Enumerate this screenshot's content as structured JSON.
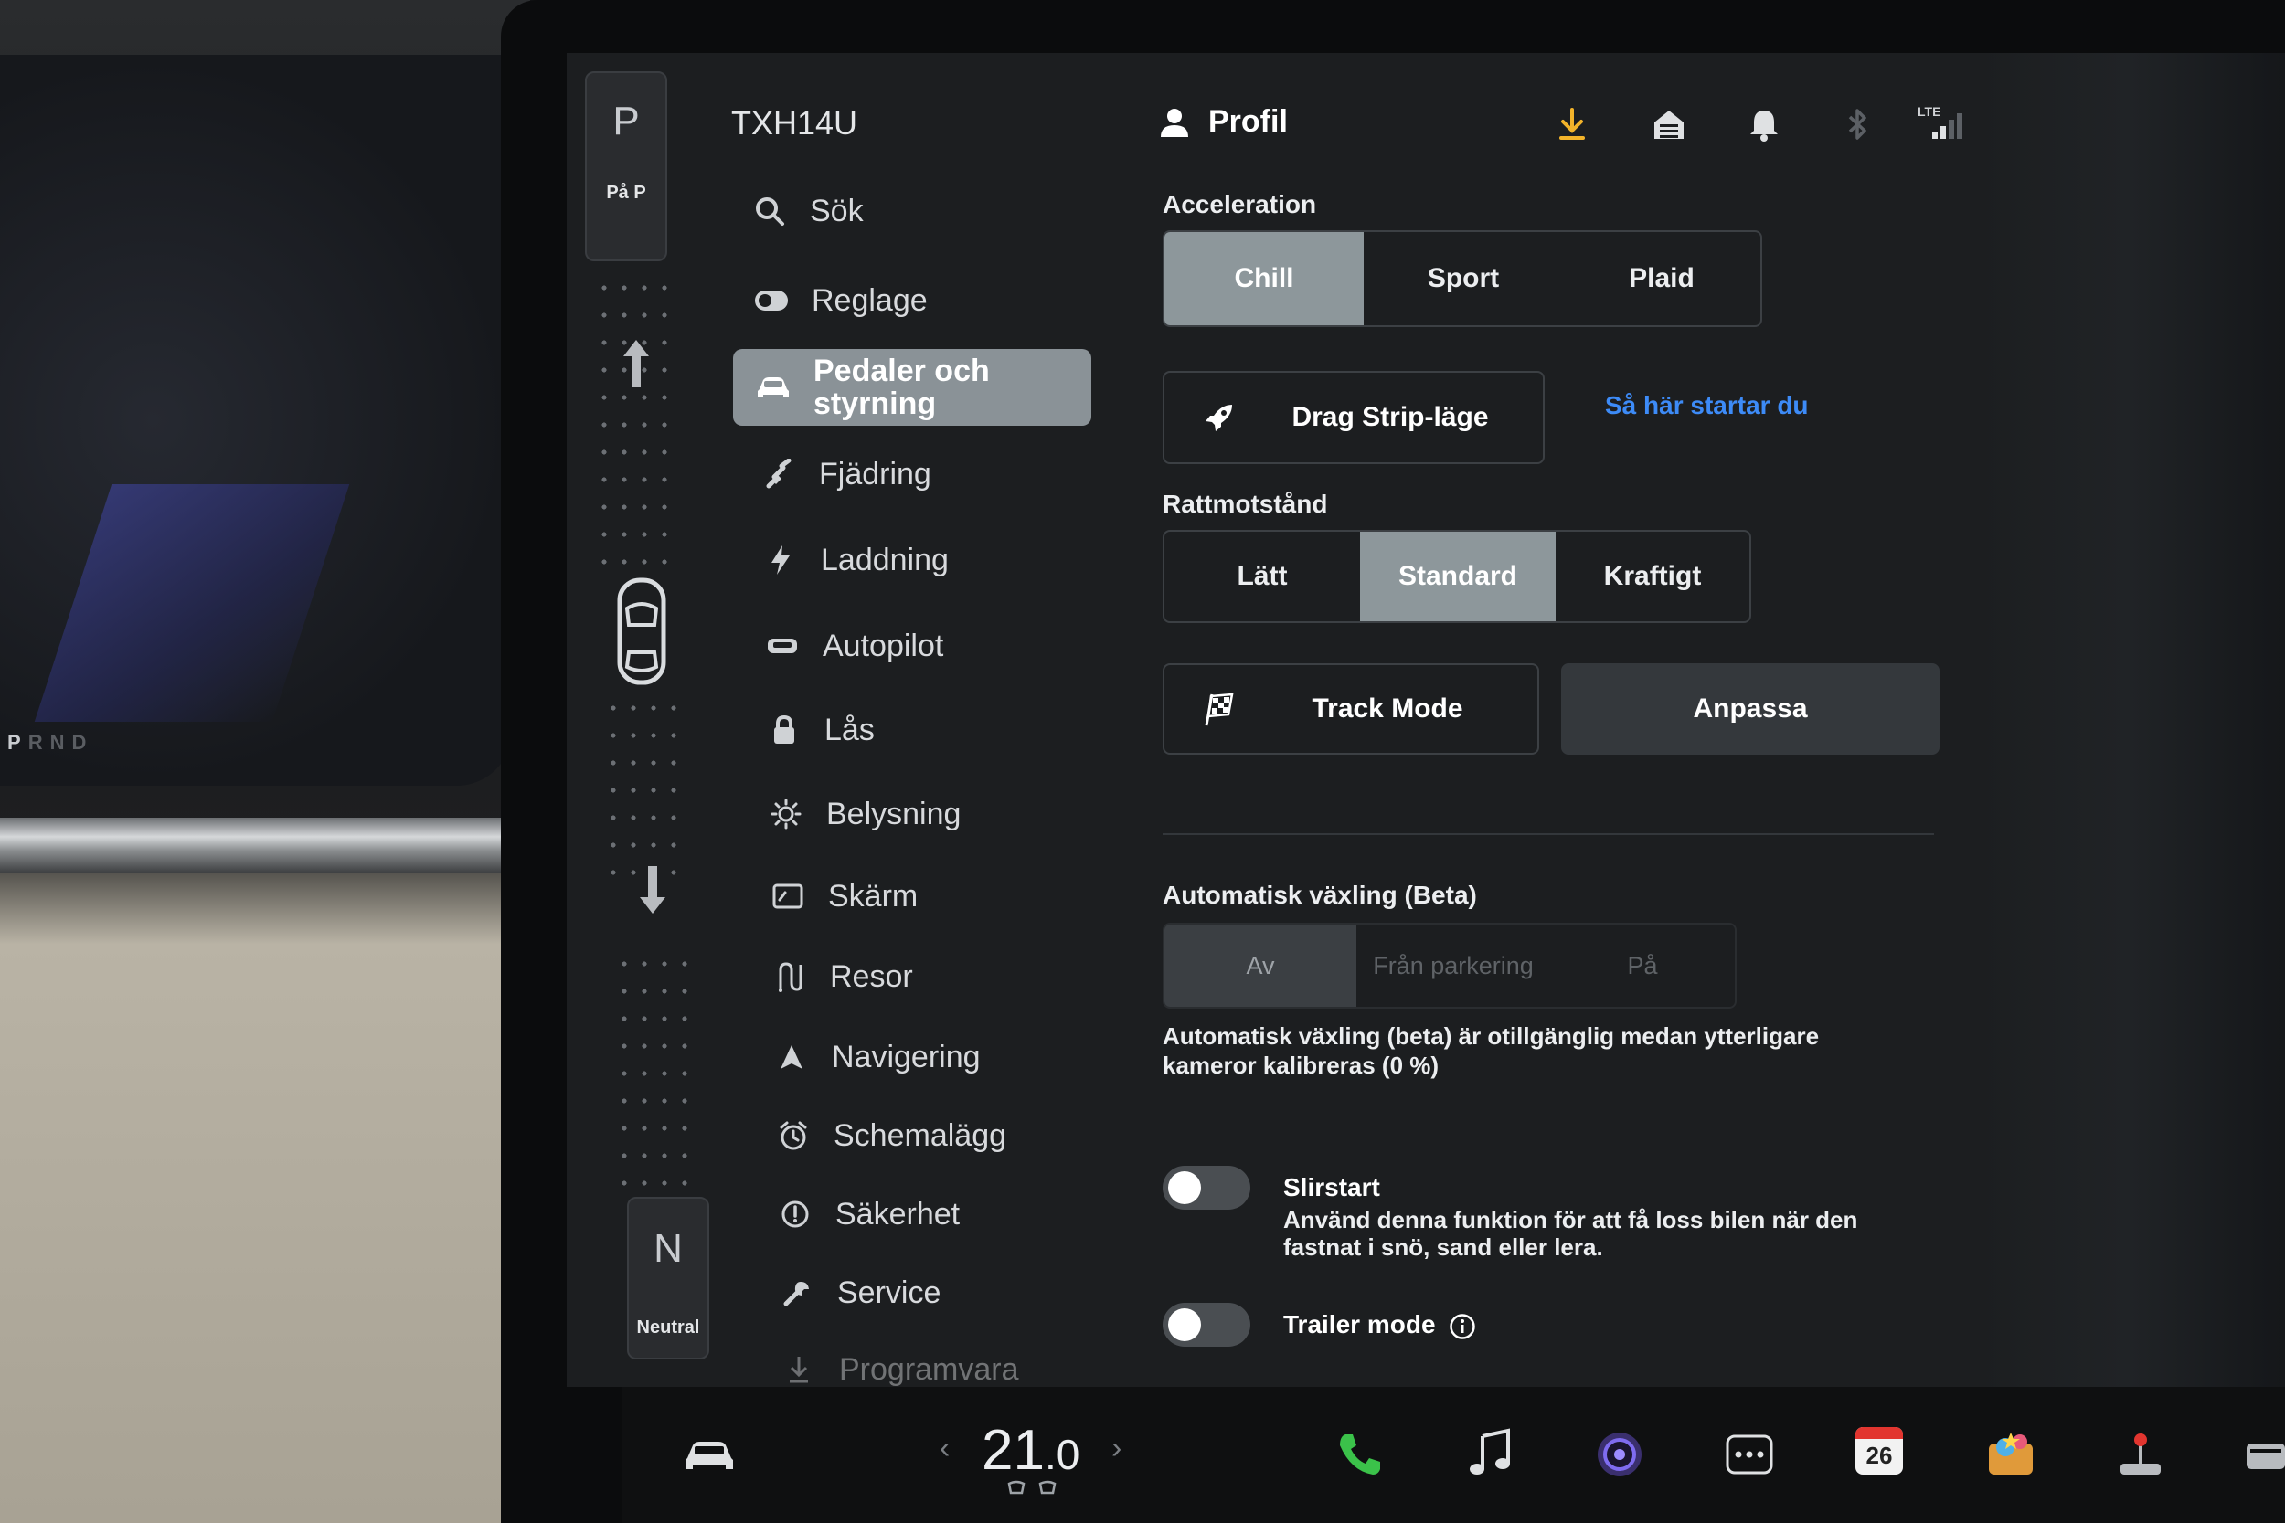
{
  "vehicle": {
    "name": "TXH14U"
  },
  "gear": {
    "top_letter": "P",
    "top_sub": "På P",
    "bottom_letter": "N",
    "bottom_sub": "Neutral"
  },
  "cluster": {
    "prnd_active": "P",
    "prnd_rest": "RND"
  },
  "sidebar": {
    "items": [
      {
        "label": "Sök",
        "icon": "search-icon"
      },
      {
        "label": "Reglage",
        "icon": "toggle-icon"
      },
      {
        "label": "Pedaler och styrning",
        "icon": "car-icon"
      },
      {
        "label": "Fjädring",
        "icon": "suspension-icon"
      },
      {
        "label": "Laddning",
        "icon": "lightning-icon"
      },
      {
        "label": "Autopilot",
        "icon": "steering-wheel-icon"
      },
      {
        "label": "Lås",
        "icon": "lock-icon"
      },
      {
        "label": "Belysning",
        "icon": "sun-icon"
      },
      {
        "label": "Skärm",
        "icon": "display-icon"
      },
      {
        "label": "Resor",
        "icon": "route-icon"
      },
      {
        "label": "Navigering",
        "icon": "navigation-arrow-icon"
      },
      {
        "label": "Schemalägg",
        "icon": "alarm-clock-icon"
      },
      {
        "label": "Säkerhet",
        "icon": "alert-circle-icon"
      },
      {
        "label": "Service",
        "icon": "wrench-icon"
      },
      {
        "label": "Programvara",
        "icon": "download-icon"
      }
    ],
    "active_index": 2
  },
  "header": {
    "profile_label": "Profil",
    "lte_label": "LTE",
    "download_color": "#f2b32a"
  },
  "acceleration": {
    "title": "Acceleration",
    "options": [
      "Chill",
      "Sport",
      "Plaid"
    ],
    "selected": "Chill",
    "drag_strip_label": "Drag Strip-läge",
    "how_to_link": "Så här startar du"
  },
  "steering": {
    "title": "Rattmotstånd",
    "options": [
      "Lätt",
      "Standard",
      "Kraftigt"
    ],
    "selected": "Standard",
    "track_mode_label": "Track Mode",
    "customize_label": "Anpassa"
  },
  "auto_shift": {
    "title": "Automatisk växling (Beta)",
    "options": [
      "Av",
      "Från parkering",
      "På"
    ],
    "selected": "Av",
    "note": "Automatisk växling (beta) är otillgänglig medan ytterligare kameror kalibreras (0 %)"
  },
  "slip_start": {
    "title": "Slirstart",
    "description": "Använd denna funktion för att få loss bilen när den fastnat i snö, sand eller lera.",
    "enabled": false
  },
  "trailer": {
    "title": "Trailer mode",
    "enabled": false
  },
  "dock": {
    "temp_whole": "21",
    "temp_decimal": ".0",
    "temp_left_arrow": "‹",
    "temp_right_arrow": "›",
    "calendar_day": "26"
  },
  "colors": {
    "accent_link": "#3d8bf7",
    "selected_segment": "#8d979b",
    "phone_green": "#3bc24a"
  }
}
